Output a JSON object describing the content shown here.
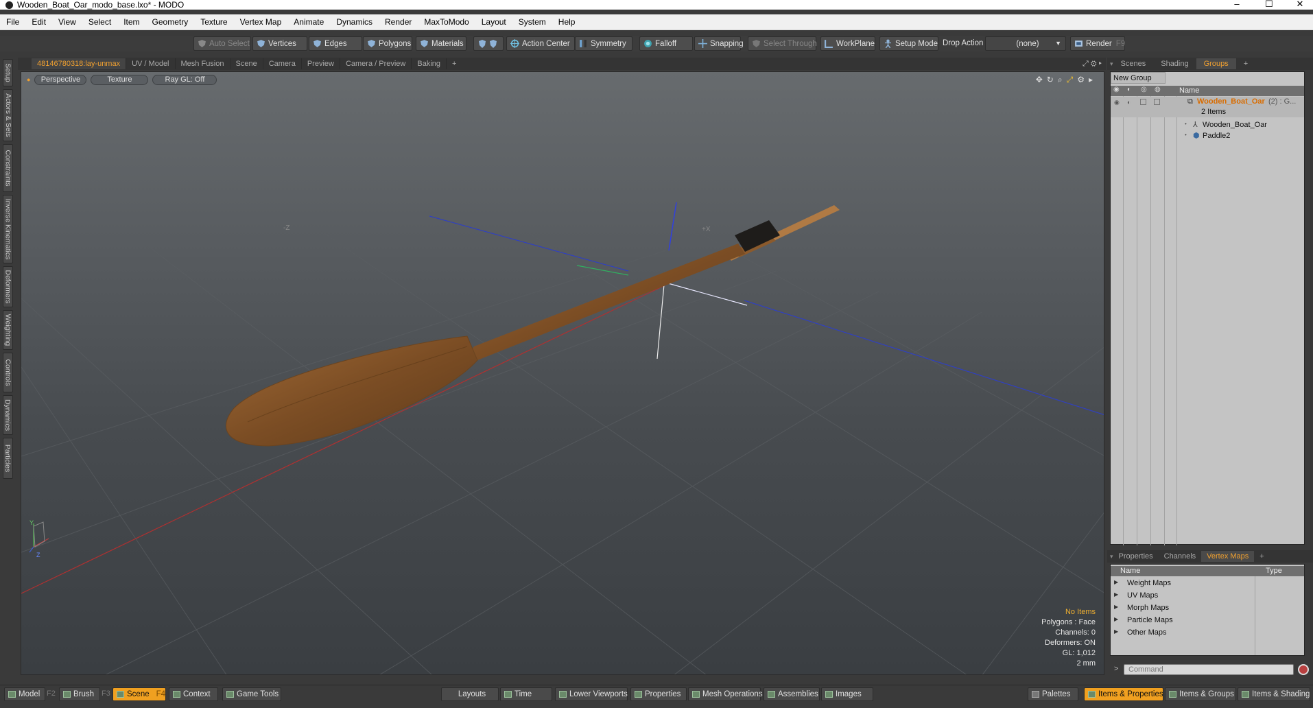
{
  "window": {
    "title": "Wooden_Boat_Oar_modo_base.lxo* - MODO",
    "controls": [
      "–",
      "☐",
      "✕"
    ]
  },
  "menu": [
    "File",
    "Edit",
    "View",
    "Select",
    "Item",
    "Geometry",
    "Texture",
    "Vertex Map",
    "Animate",
    "Dynamics",
    "Render",
    "MaxToModo",
    "Layout",
    "System",
    "Help"
  ],
  "toolbar": {
    "auto_select": "Auto Select",
    "vertices": "Vertices",
    "edges": "Edges",
    "polygons": "Polygons",
    "materials": "Materials",
    "action_center": "Action Center",
    "symmetry": "Symmetry",
    "falloff": "Falloff",
    "snapping": "Snapping",
    "select_through": "Select Through",
    "workplane": "WorkPlane",
    "setup_mode": "Setup Mode",
    "drop_action_label": "Drop Action",
    "drop_action_value": "(none)",
    "render": "Render",
    "render_key": "F9"
  },
  "left_tabs": [
    "Setup",
    "Actors & Sets",
    "Constraints",
    "Inverse Kinematics",
    "Deformers",
    "Weighting",
    "Controls",
    "Dynamics",
    "Particles"
  ],
  "viewport_tabs": [
    "48146780318:lay-unmax",
    "UV / Model",
    "Mesh Fusion",
    "Scene",
    "Camera",
    "Preview",
    "Camera / Preview",
    "Baking",
    "+"
  ],
  "viewport": {
    "view": "Perspective",
    "shading": "Texture",
    "raygl": "Ray GL: Off",
    "axis_label_neg_z": "-Z",
    "axis_label_pos_x": "+X",
    "gizmo_y": "Y",
    "gizmo_z": "Z",
    "stats": {
      "items": "No Items",
      "polygons": "Polygons : Face",
      "channels": "Channels: 0",
      "deformers": "Deformers: ON",
      "gl": "GL: 1,012",
      "unit": "2 mm"
    }
  },
  "right_tabs": [
    "Scenes",
    "Shading",
    "Groups",
    "+"
  ],
  "groups": {
    "new_group": "New Group",
    "name_header": "Name",
    "group_name": "Wooden_Boat_Oar",
    "group_suffix": "(2) : G...",
    "count": "2 Items",
    "children": [
      "Wooden_Boat_Oar",
      "Paddle2"
    ]
  },
  "lower_tabs": [
    "Properties",
    "Channels",
    "Vertex Maps",
    "+"
  ],
  "vertex_maps": {
    "name_header": "Name",
    "type_header": "Type",
    "rows": [
      "Weight Maps",
      "UV Maps",
      "Morph Maps",
      "Particle Maps",
      "Other Maps"
    ]
  },
  "command": {
    "prompt": ">",
    "placeholder": "Command"
  },
  "bottom": {
    "model": "Model",
    "model_key": "F2",
    "brush": "Brush",
    "brush_key": "F3",
    "scene": "Scene",
    "scene_key": "F4",
    "context": "Context",
    "game_tools": "Game Tools",
    "layouts": "Layouts",
    "time": "Time",
    "lower_viewports": "Lower Viewports",
    "properties": "Properties",
    "mesh_operations": "Mesh Operations",
    "assemblies": "Assemblies",
    "images": "Images",
    "palettes": "Palettes",
    "items_properties": "Items & Properties",
    "items_groups": "Items & Groups",
    "items_shading": "Items & Shading"
  },
  "colors": {
    "accent": "#f0a020",
    "viewport_top": "#676b6e",
    "viewport_bottom": "#3a3e42",
    "wood": "#8a5a2c",
    "grip": "#1e1c1a"
  }
}
